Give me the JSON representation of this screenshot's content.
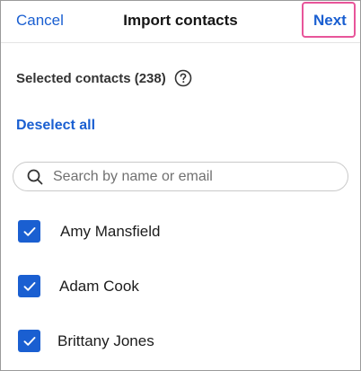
{
  "header": {
    "cancel_label": "Cancel",
    "title": "Import contacts",
    "next_label": "Next",
    "highlight_color": "#e8559a"
  },
  "selection": {
    "label": "Selected contacts (238)",
    "help_icon": "question-circle-icon",
    "deselect_label": "Deselect all"
  },
  "search": {
    "icon": "search-icon",
    "placeholder": "Search by name or email",
    "value": ""
  },
  "contacts": [
    {
      "name": "Amy Mansfield",
      "checked": true
    },
    {
      "name": "Adam Cook",
      "checked": true
    },
    {
      "name": "Brittany Jones",
      "checked": true
    }
  ],
  "colors": {
    "accent": "#1a5fd1",
    "text": "#151515"
  }
}
